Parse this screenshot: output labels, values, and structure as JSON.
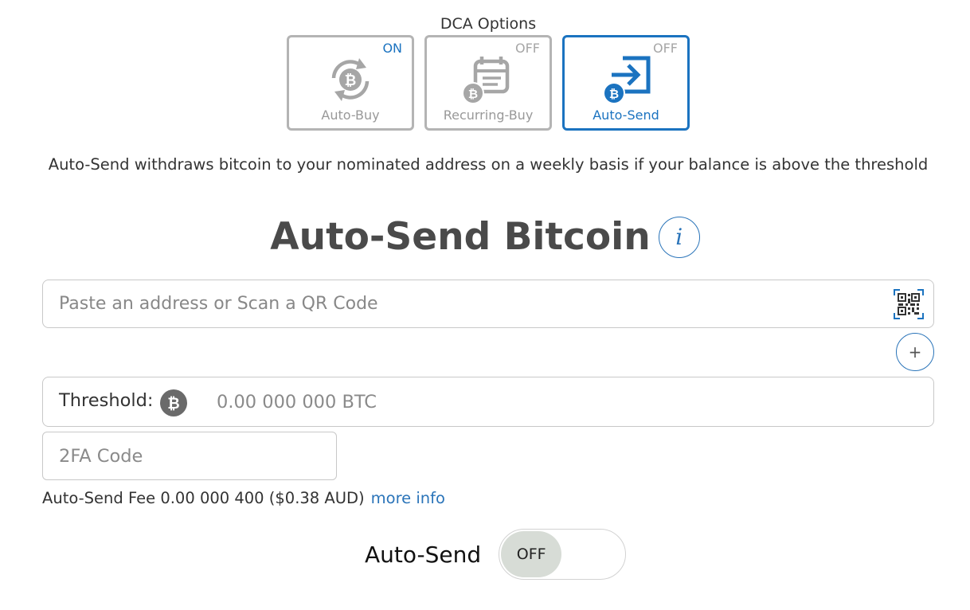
{
  "dca": {
    "title": "DCA Options",
    "options": [
      {
        "label": "Auto-Buy",
        "status": "ON",
        "icon": "bitcoin-refresh-icon"
      },
      {
        "label": "Recurring-Buy",
        "status": "OFF",
        "icon": "bitcoin-calendar-icon"
      },
      {
        "label": "Auto-Send",
        "status": "OFF",
        "icon": "bitcoin-send-icon"
      }
    ]
  },
  "description": "Auto-Send withdraws bitcoin to your nominated address on a weekly basis if your balance is above the threshold",
  "heading": "Auto-Send Bitcoin",
  "info_icon_glyph": "i",
  "address": {
    "placeholder": "Paste an address or Scan a QR Code",
    "value": ""
  },
  "add_button_glyph": "+",
  "threshold": {
    "label": "Threshold:",
    "placeholder": "0.00 000 000 BTC",
    "value": ""
  },
  "twofa": {
    "placeholder": "2FA Code",
    "value": ""
  },
  "fee": {
    "text": "Auto-Send Fee 0.00 000 400 ($0.38 AUD)",
    "link": "more info"
  },
  "toggle": {
    "label": "Auto-Send",
    "state": "OFF"
  },
  "colors": {
    "accent": "#1b73c0",
    "inactive": "#a6a6a6",
    "heading": "#4a4a4a",
    "toggle_knob": "#d7dcd6"
  }
}
